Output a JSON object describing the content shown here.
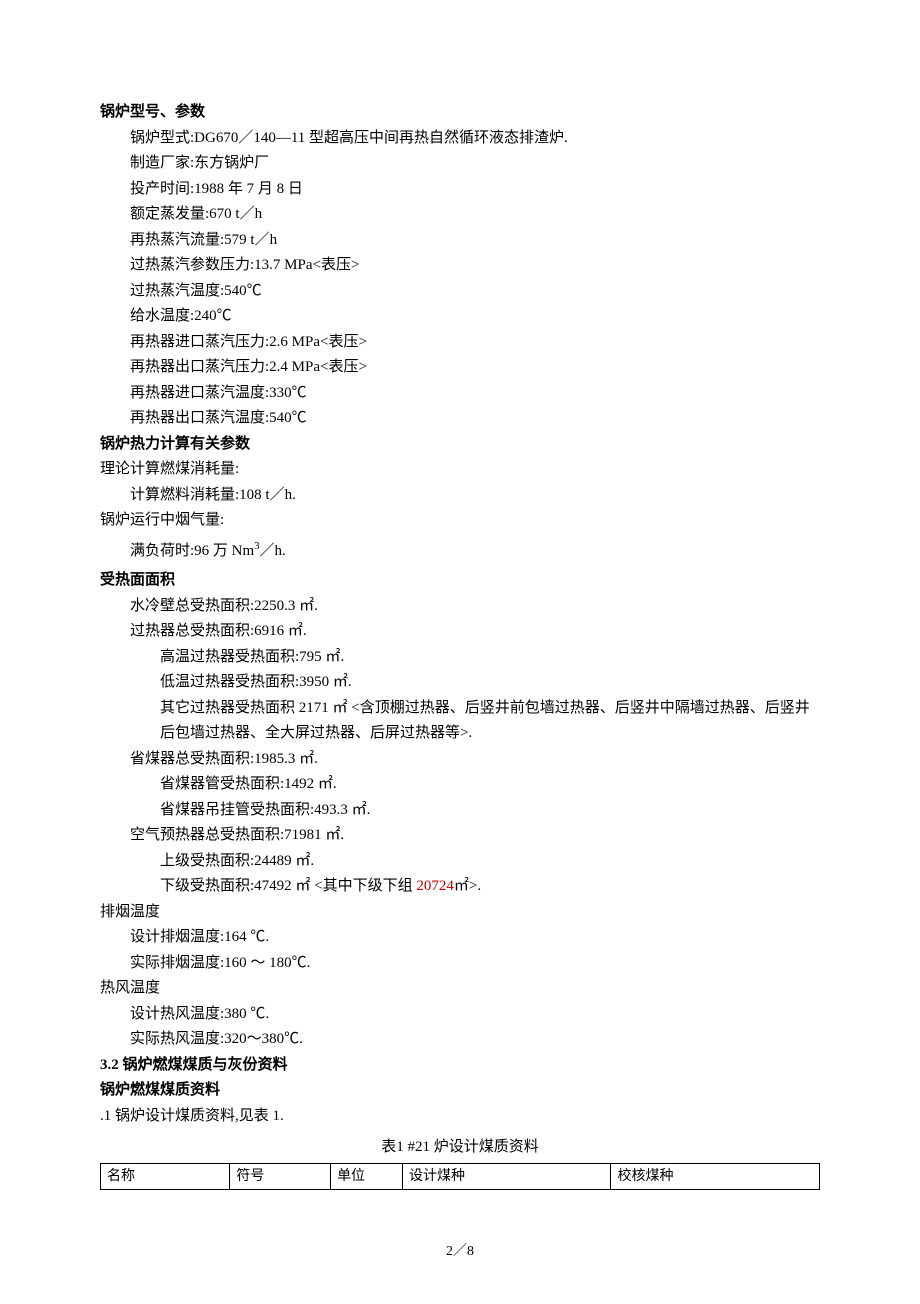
{
  "sections": {
    "s1": {
      "title": "锅炉型号、参数"
    },
    "s2": {
      "title": "锅炉热力计算有关参数"
    },
    "s3": {
      "title": "受热面面积"
    },
    "s4": {
      "title": "3.2 锅炉燃煤煤质与灰份资料"
    },
    "s5": {
      "title": "锅炉燃煤煤质资料"
    }
  },
  "boiler": {
    "type_label": "锅炉型式:",
    "type_value": "DG670／140—11 型超高压中间再热自然循环液态排渣炉.",
    "mfr_label": "制造厂家:",
    "mfr_value": "东方锅炉厂",
    "date_label": "投产时间:",
    "date_value": "1988 年 7 月 8 日",
    "evap_label": "额定蒸发量:",
    "evap_value": "670 t／h",
    "reheat_flow_label": "再热蒸汽流量:",
    "reheat_flow_value": "579 t／h",
    "sh_press_label": "过热蒸汽参数压力:",
    "sh_press_value": "13.7 MPa<表压>",
    "sh_temp_label": "过热蒸汽温度:",
    "sh_temp_value": "540℃",
    "fw_temp_label": "给水温度:",
    "fw_temp_value": "240℃",
    "rh_in_press_label": "再热器进口蒸汽压力:",
    "rh_in_press_value": "2.6 MPa<表压>",
    "rh_out_press_label": "再热器出口蒸汽压力:",
    "rh_out_press_value": "2.4 MPa<表压>",
    "rh_in_temp_label": "再热器进口蒸汽温度:",
    "rh_in_temp_value": "330℃",
    "rh_out_temp_label": "再热器出口蒸汽温度:",
    "rh_out_temp_value": "540℃"
  },
  "thermal": {
    "theory_label": "理论计算燃煤消耗量:",
    "fuel_label": "计算燃料消耗量:",
    "fuel_value": "108 t／h.",
    "gas_label": "锅炉运行中烟气量:",
    "full_label": "满负荷时:",
    "full_value_pre": "96 万 Nm",
    "full_value_post": "／h."
  },
  "heat": {
    "ww_label": "水冷壁总受热面积:",
    "ww_value": "2250.3 ㎡.",
    "sh_label": "过热器总受热面积:",
    "sh_value": "6916 ㎡.",
    "sh_hi_label": "高温过热器受热面积:",
    "sh_hi_value": "795 ㎡.",
    "sh_lo_label": "低温过热器受热面积:",
    "sh_lo_value": "3950 ㎡.",
    "sh_other_label": "其它过热器受热面积",
    "sh_other_value": "2171 ㎡ <含顶棚过热器、后竖井前包墙过热器、后竖井中隔墙过热器、后竖井后包墙过热器、全大屏过热器、后屏过热器等>.",
    "eco_label": "省煤器总受热面积:",
    "eco_value": "1985.3 ㎡.",
    "eco_tube_label": "省煤器管受热面积:",
    "eco_tube_value": "1492 ㎡.",
    "eco_hang_label": "省煤器吊挂管受热面积:",
    "eco_hang_value": "493.3 ㎡.",
    "aph_label": "空气预热器总受热面积:",
    "aph_value": "71981 ㎡.",
    "aph_up_label": "上级受热面积:",
    "aph_up_value": "24489 ㎡.",
    "aph_lo_label": "下级受热面积:",
    "aph_lo_value_pre": "47492 ㎡ <其中下级下组 ",
    "aph_lo_value_red": "20724",
    "aph_lo_value_post": "㎡>."
  },
  "exhaust": {
    "section": "排烟温度",
    "design_label": "设计排烟温度:",
    "design_value": "164 ℃.",
    "actual_label": "实际排烟温度:",
    "actual_value": "160 ～ 180℃."
  },
  "hotair": {
    "section": "热风温度",
    "design_label": "设计热风温度:",
    "design_value": "380 ℃.",
    "actual_label": "实际热风温度:",
    "actual_value": "320～380℃."
  },
  "coal": {
    "note": ".1  锅炉设计煤质资料,见表 1."
  },
  "table": {
    "caption": "表1    #21 炉设计煤质资料",
    "h1": "名称",
    "h2": "符号",
    "h3": "单位",
    "h4": "设计煤种",
    "h5": "校核煤种"
  },
  "footer": "2／8"
}
